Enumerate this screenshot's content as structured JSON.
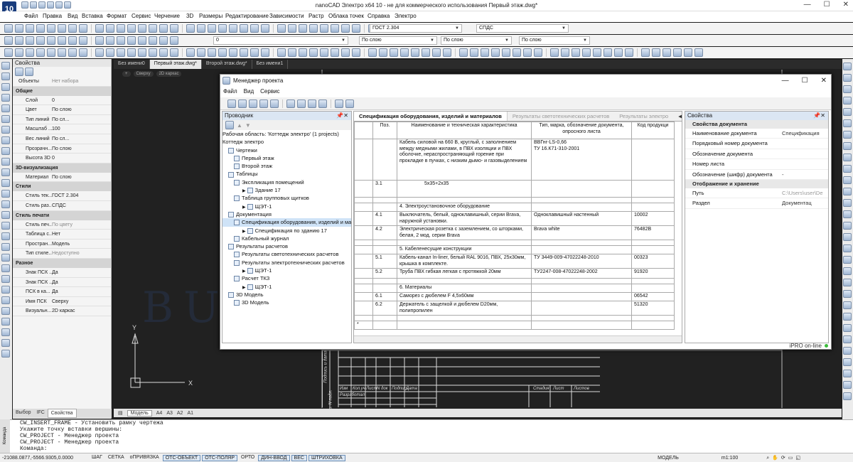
{
  "app": {
    "logo": "10",
    "title": "nanoCAD Электро x64 10 - не для коммерческого использования Первый этаж.dwg*"
  },
  "menu": [
    "Файл",
    "Правка",
    "Вид",
    "Вставка",
    "Формат",
    "Сервис",
    "Черчение",
    "3D",
    "Размеры",
    "Редактирование",
    "Зависимости",
    "Растр",
    "Облака точек",
    "Справка",
    "Электро"
  ],
  "toolbar": {
    "textstyle": "ГОСТ 2.304",
    "dimstyle": "СПДС",
    "layer": "0",
    "color": "По слою",
    "linetype": "По слою",
    "lineweight": "По слою"
  },
  "properties": {
    "title": "Свойства",
    "objects_label": "Объекты",
    "objects_value": "Нет набора",
    "sections": [
      {
        "title": "Общие",
        "rows": [
          [
            "Слой",
            "0"
          ],
          [
            "Цвет",
            "По слою"
          ],
          [
            "Тип линий",
            "По сл..."
          ],
          [
            "Масштаб ...",
            "100"
          ],
          [
            "Вес линий",
            "По сл..."
          ],
          [
            "Прозрачн...",
            "По слою"
          ],
          [
            "Высота 3D",
            "0"
          ]
        ]
      },
      {
        "title": "3D-визуализация",
        "rows": [
          [
            "Материал",
            "По слою"
          ]
        ]
      },
      {
        "title": "Стили",
        "rows": [
          [
            "Стиль тек...",
            "ГОСТ 2.304"
          ],
          [
            "Стиль раз...",
            "СПДС"
          ]
        ]
      },
      {
        "title": "Стиль печати",
        "rows": [
          [
            "Стиль печ...",
            "По цвету"
          ],
          [
            "Таблица с...",
            "Нет"
          ],
          [
            "Простран...",
            "Модель"
          ],
          [
            "Тип стиле...",
            "Недоступно"
          ]
        ]
      },
      {
        "title": "Разное",
        "rows": [
          [
            "Знак ПСК ...",
            "Да"
          ],
          [
            "Знак ПСК ...",
            "Да"
          ],
          [
            "ПСК в ка...",
            "Да"
          ],
          [
            "Имя ПСК",
            "Сверху"
          ],
          [
            "Визуальн...",
            "2D каркас"
          ]
        ]
      }
    ],
    "tabs": [
      "Выбор",
      "IFC",
      "Свойства"
    ]
  },
  "doc_tabs": [
    "Без имени0",
    "Первый этаж.dwg*",
    "Второй этаж.dwg*",
    "Без имени1"
  ],
  "view_tags": [
    "+",
    "Сверху",
    "2D каркас"
  ],
  "layout_tabs": [
    "Модель",
    "A4",
    "A3",
    "A2",
    "A1"
  ],
  "watermark": "BUILDSOFT",
  "axis": {
    "y": "Y",
    "x": "X"
  },
  "pm": {
    "title": "Менеджер проекта",
    "menu": [
      "Файл",
      "Вид",
      "Сервис"
    ],
    "explorer_title": "Проводник",
    "tree": [
      {
        "t": "Рабочая область: 'Коттедж электро' (1 projects)",
        "l": 0
      },
      {
        "t": "Коттедж электро",
        "l": 0
      },
      {
        "t": "Чертежи",
        "l": 1
      },
      {
        "t": "Первый этаж",
        "l": 2
      },
      {
        "t": "Второй этаж",
        "l": 2
      },
      {
        "t": "Таблицы",
        "l": 1
      },
      {
        "t": "Экспликация помещений",
        "l": 2
      },
      {
        "t": "Здание 17",
        "l": 3
      },
      {
        "t": "Таблица групповых щитков",
        "l": 2
      },
      {
        "t": "ЩЭТ-1",
        "l": 3
      },
      {
        "t": "Документация",
        "l": 1
      },
      {
        "t": "Спецификация оборудования, изделий и материалов",
        "l": 2,
        "sel": true
      },
      {
        "t": "Спецификация по зданию 17",
        "l": 3
      },
      {
        "t": "Кабельный журнал",
        "l": 2
      },
      {
        "t": "Результаты расчетов",
        "l": 1
      },
      {
        "t": "Результаты светотехнических расчетов",
        "l": 2
      },
      {
        "t": "Результаты электротехнических расчетов",
        "l": 2
      },
      {
        "t": "ЩЭТ-1",
        "l": 3
      },
      {
        "t": "Расчет ТКЗ",
        "l": 2
      },
      {
        "t": "ЩЭТ-1",
        "l": 3
      },
      {
        "t": "3D Модель",
        "l": 1
      },
      {
        "t": "3D Модель",
        "l": 2
      }
    ],
    "spec_tabs": [
      "Спецификация оборудования, изделий и материалов",
      "Результаты светотехнических расчетов",
      "Результаты электро"
    ],
    "columns": [
      "Поз.",
      "Наименование и техническая характеристика",
      "Тип, марка, обозначение документа, опросного листа",
      "Код продукци"
    ],
    "rows": [
      {
        "pos": "",
        "name": "Кабель силовой на 660 В, круглый, с заполнением между медными жилами, в ПВХ изоляции и ПВХ оболочке, нераспространяющий горение при прокладке в пучках, с низким дымо- и газовыделением",
        "type": "ВВГнг-LS-0,66\nТУ 16.К71-310-2001",
        "code": ""
      },
      {
        "pos": "3.1",
        "name": "5x35+2x35",
        "type": "",
        "code": ""
      },
      {
        "pos": "",
        "name": "",
        "type": "",
        "code": ""
      },
      {
        "pos": "",
        "name": "4. Электроустановочное оборудование",
        "type": "",
        "code": ""
      },
      {
        "pos": "4.1",
        "name": "Выключатель, белый, одноклавишный, серии Brava, наружной установки.",
        "type": "Одноклавишный настенный",
        "code": "10002"
      },
      {
        "pos": "4.2",
        "name": "Электрическая розетка с заземлением, со шторками, белая, 2 мод. серии Brava",
        "type": "Brava white",
        "code": "76482B"
      },
      {
        "pos": "",
        "name": "",
        "type": "",
        "code": ""
      },
      {
        "pos": "",
        "name": "5. Кабеленесущие конструкции",
        "type": "",
        "code": ""
      },
      {
        "pos": "5.1",
        "name": "Кабель-канал In-liner, белый RAL 9016, ПВХ, 25x30мм, крышка в комплекте.",
        "type": "ТУ 3449-009-47022248-2010",
        "code": "00323"
      },
      {
        "pos": "5.2",
        "name": "Труба ПВХ гибкая легкая с протяжкой 20мм",
        "type": "ТУ2247-008-47022248-2002",
        "code": "91920"
      },
      {
        "pos": "",
        "name": "",
        "type": "",
        "code": ""
      },
      {
        "pos": "",
        "name": "6. Материалы",
        "type": "",
        "code": ""
      },
      {
        "pos": "6.1",
        "name": "Саморез с дюбелем F 4,5x60мм",
        "type": "",
        "code": "06542"
      },
      {
        "pos": "6.2",
        "name": "Держатель с защелкой и дюбелем D20мм, полипропилен",
        "type": "",
        "code": "51320"
      },
      {
        "pos": "",
        "name": "",
        "type": "",
        "code": ""
      },
      {
        "pos": "*",
        "name": "",
        "type": "",
        "code": ""
      }
    ],
    "props_title": "Свойства",
    "prop_sections": [
      {
        "title": "Свойства документа",
        "rows": [
          [
            "Наименование документа",
            "Спецификация"
          ],
          [
            "Порядковый номер документа",
            ""
          ],
          [
            "Обозначение документа",
            ""
          ],
          [
            "Номер листа",
            ""
          ],
          [
            "Обозначение (шифр) документа",
            "-"
          ]
        ]
      },
      {
        "title": "Отображение и хранение",
        "rows": [
          [
            "Путь",
            "C:\\Users\\user\\De"
          ],
          [
            "Раздел",
            "Документац"
          ]
        ]
      }
    ],
    "status": "iPRO on-line"
  },
  "titleblock": {
    "labels": [
      "Изм",
      "Кол.уч",
      "Лист",
      "N док",
      "Подпись",
      "Дата",
      "Разработал",
      "Стадия",
      "Лист",
      "Листов"
    ],
    "vertical": [
      "Подпись и дата",
      "Инв. N подл."
    ]
  },
  "command": {
    "side": "Команда",
    "lines": [
      "CW_INSERT_FRAME - Установить рамку чертежа",
      "Укажите точку вставки вершины:",
      "CW_PROJECT - Менеджер проекта",
      "CW_PROJECT - Менеджер проекта",
      "Команда:"
    ]
  },
  "statusbar": {
    "coords": "-21088.0877,-5566.9305,0.0000",
    "toggles": [
      [
        "ШАГ",
        false
      ],
      [
        "СЕТКА",
        false
      ],
      [
        "оПРИВЯЗКА",
        false
      ],
      [
        "ОТС-ОБЪЕКТ",
        true
      ],
      [
        "ОТС-ПОЛЯР",
        true
      ],
      [
        "ОРТО",
        false
      ],
      [
        "ДИН-ВВОД",
        true
      ],
      [
        "ВЕС",
        true
      ],
      [
        "ШТРИХОВКА",
        true
      ]
    ],
    "mode": "МОДЕЛЬ",
    "scale": "m1:100"
  }
}
